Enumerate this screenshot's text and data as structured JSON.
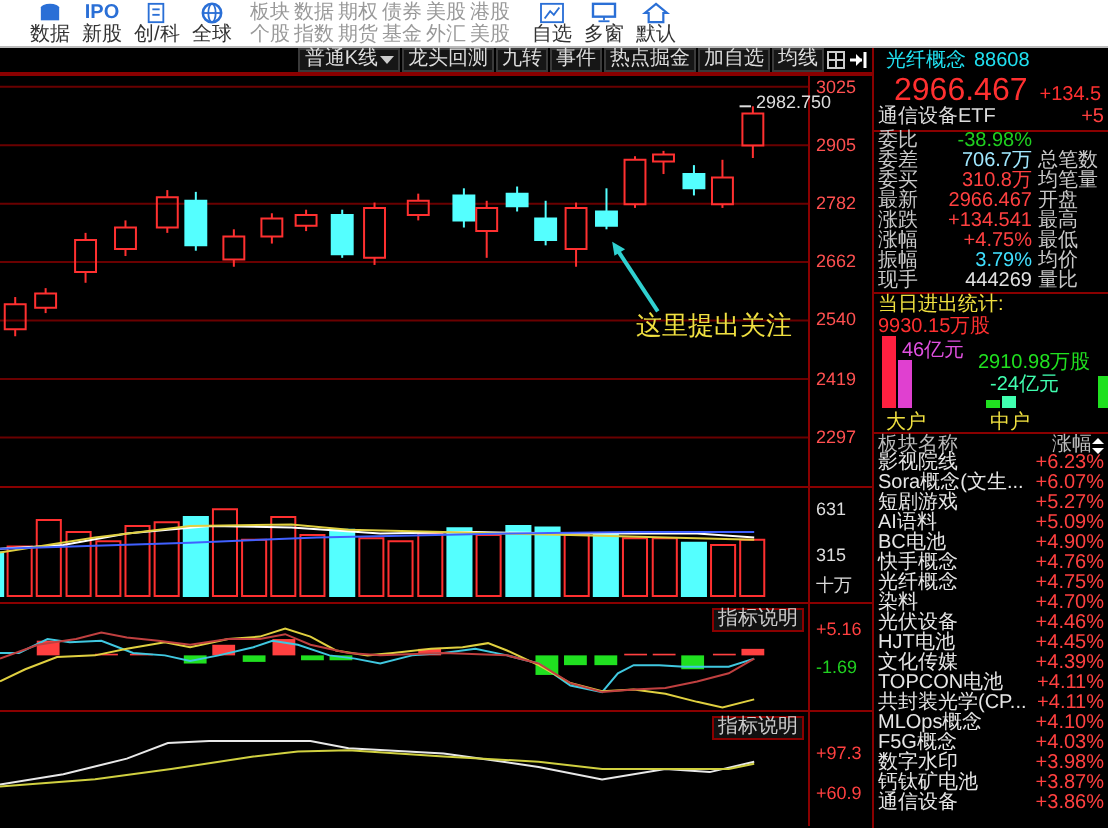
{
  "toolbar": {
    "buttons": [
      {
        "label": "数据",
        "kind": "database"
      },
      {
        "label": "新股",
        "kind": "ipo",
        "icon_text": "IPO"
      },
      {
        "label": "创/科",
        "kind": "document"
      },
      {
        "label": "全球",
        "kind": "globe"
      }
    ],
    "market_grid": [
      [
        "板块",
        "数据",
        "期权",
        "债券",
        "美股",
        "港股"
      ],
      [
        "个股",
        "指数",
        "期货",
        "基金",
        "外汇",
        "美股"
      ]
    ],
    "right_buttons": [
      {
        "label": "自选",
        "kind": "chart"
      },
      {
        "label": "多窗",
        "kind": "monitor"
      },
      {
        "label": "默认",
        "kind": "home"
      }
    ]
  },
  "chart_bar": {
    "items": [
      {
        "label": "普通K线",
        "kind": "dropdown"
      },
      {
        "label": "龙头回测",
        "kind": "text"
      },
      {
        "label": "九转",
        "kind": "text"
      },
      {
        "label": "事件",
        "kind": "text"
      },
      {
        "label": "热点掘金",
        "kind": "text"
      },
      {
        "label": "加自选",
        "kind": "text"
      },
      {
        "label": "均线",
        "kind": "text"
      },
      {
        "kind": "grid"
      },
      {
        "kind": "pin"
      }
    ]
  },
  "instrument": {
    "name": "光纤概念",
    "code": "88608"
  },
  "price_chart": {
    "yticks": [
      "3025",
      "2905",
      "2782",
      "2662",
      "2540",
      "2419",
      "2297"
    ],
    "high_label": "2982.750",
    "note": "这里提出关注"
  },
  "volume_chart": {
    "yticks": [
      "631",
      "315"
    ],
    "unit": "十万"
  },
  "macd_chart": {
    "button": "指标说明",
    "yticks": [
      {
        "label": "+5.16",
        "color": "#ff4040"
      },
      {
        "label": "-1.69",
        "color": "#20d020"
      }
    ]
  },
  "kdj_chart": {
    "button": "指标说明",
    "yticks": [
      {
        "label": "+97.3",
        "color": "#ff4040"
      },
      {
        "label": "+60.9",
        "color": "#ff4040"
      }
    ]
  },
  "quote": {
    "price": "2966.467",
    "change": "+134.5",
    "etf": {
      "name": "通信设备ETF",
      "change": "+5"
    },
    "rows": [
      {
        "label": "委比",
        "value": "-38.98%",
        "color": "#20d020"
      },
      {
        "label": "委差",
        "value": "706.7万",
        "color": "#a0e8ff",
        "extra": "总笔数"
      },
      {
        "label": "委买",
        "value": "310.8万",
        "color": "#ff4040",
        "extra": "均笔量"
      },
      {
        "label": "最新",
        "value": "2966.467",
        "color": "#ff4040",
        "extra": "开盘"
      },
      {
        "label": "涨跌",
        "value": "+134.541",
        "color": "#ff4040",
        "extra": "最高"
      },
      {
        "label": "涨幅",
        "value": "+4.75%",
        "color": "#ff4040",
        "extra": "最低"
      },
      {
        "label": "振幅",
        "value": "3.79%",
        "color": "#40e0ff",
        "extra": "均价"
      },
      {
        "label": "现手",
        "value": "444269",
        "color": "#e0e0e0",
        "extra": "量比"
      }
    ]
  },
  "flows": {
    "title": "当日进出统计:",
    "groups": [
      {
        "label": "大户",
        "volume": "9930.15万股",
        "amount": "46亿元"
      },
      {
        "label": "中户",
        "volume": "2910.98万股",
        "amount": "-24亿元"
      }
    ]
  },
  "sectors": {
    "header": {
      "name": "板块名称",
      "change": "涨幅"
    },
    "rows": [
      {
        "name": "影视院线",
        "change": "+6.23%"
      },
      {
        "name": "Sora概念(文生...",
        "change": "+6.07%"
      },
      {
        "name": "短剧游戏",
        "change": "+5.27%"
      },
      {
        "name": "AI语料",
        "change": "+5.09%"
      },
      {
        "name": "BC电池",
        "change": "+4.90%"
      },
      {
        "name": "快手概念",
        "change": "+4.76%"
      },
      {
        "name": "光纤概念",
        "change": "+4.75%"
      },
      {
        "name": "染料",
        "change": "+4.70%"
      },
      {
        "name": "光伏设备",
        "change": "+4.46%"
      },
      {
        "name": "HJT电池",
        "change": "+4.45%"
      },
      {
        "name": "文化传媒",
        "change": "+4.39%"
      },
      {
        "name": "TOPCON电池",
        "change": "+4.11%"
      },
      {
        "name": "共封装光学(CP...",
        "change": "+4.11%"
      },
      {
        "name": "MLOps概念",
        "change": "+4.10%"
      },
      {
        "name": "F5G概念",
        "change": "+4.03%"
      },
      {
        "name": "数字水印",
        "change": "+3.98%"
      },
      {
        "name": "钙钛矿电池",
        "change": "+3.87%"
      },
      {
        "name": "通信设备",
        "change": "+3.86%"
      }
    ]
  }
}
